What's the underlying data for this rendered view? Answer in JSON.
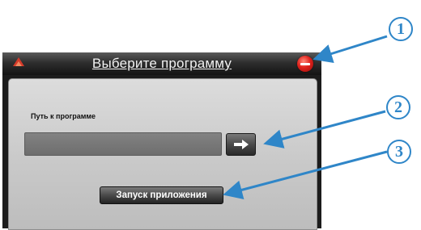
{
  "dialog": {
    "title": "Выберите программу",
    "path_label": "Путь к программе",
    "path_value": "",
    "browse_icon": "arrow-right-icon",
    "launch_label": "Запуск приложения"
  },
  "callouts": [
    "1",
    "2",
    "3"
  ],
  "colors": {
    "callout": "#2f86c8",
    "close_button": "#e0221c",
    "title_text": "#f2f2f2"
  }
}
